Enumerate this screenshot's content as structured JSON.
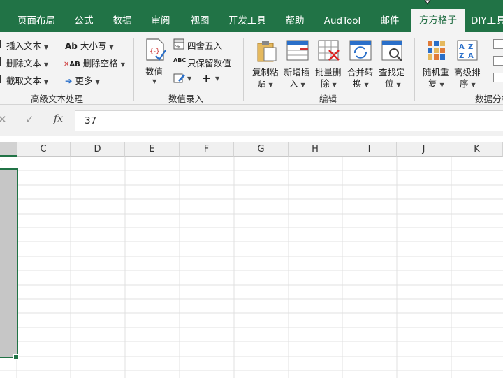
{
  "tabs": [
    {
      "label": "页面布局"
    },
    {
      "label": "公式"
    },
    {
      "label": "数据"
    },
    {
      "label": "审阅"
    },
    {
      "label": "视图"
    },
    {
      "label": "开发工具"
    },
    {
      "label": "帮助"
    },
    {
      "label": "AudTool"
    },
    {
      "label": "邮件"
    },
    {
      "label": "方方格子"
    },
    {
      "label": "DIY工具"
    }
  ],
  "ribbon": {
    "text_group": {
      "insert_text": "插入文本",
      "delete_text": "删除文本",
      "extract_text": "截取文本",
      "case": "大小写",
      "remove_spaces": "删除空格",
      "more": "更多",
      "label": "高级文本处理"
    },
    "number_group": {
      "value": "数值",
      "round": "四舍五入",
      "keep_numbers": "只保留数值",
      "label": "数值录入"
    },
    "edit_group": {
      "copy_paste_1": "复制粘",
      "copy_paste_2": "贴",
      "insert_new_1": "新增插",
      "insert_new_2": "入",
      "batch_delete_1": "批量删",
      "batch_delete_2": "除",
      "merge_convert_1": "合并转",
      "merge_convert_2": "换",
      "find_locate_1": "查找定",
      "find_locate_2": "位",
      "label": "编辑"
    },
    "data_group": {
      "random_1": "随机重",
      "random_2": "复",
      "sort_1": "高级排",
      "sort_2": "序",
      "label": "数据分析"
    }
  },
  "formula_bar": {
    "fx": "fx",
    "value": "37"
  },
  "columns": [
    "C",
    "D",
    "E",
    "F",
    "G",
    "H",
    "I",
    "J",
    "K"
  ],
  "colors": {
    "accent": "#217346",
    "selection": "#c6c6c6",
    "gridline": "#e1e1e1"
  }
}
